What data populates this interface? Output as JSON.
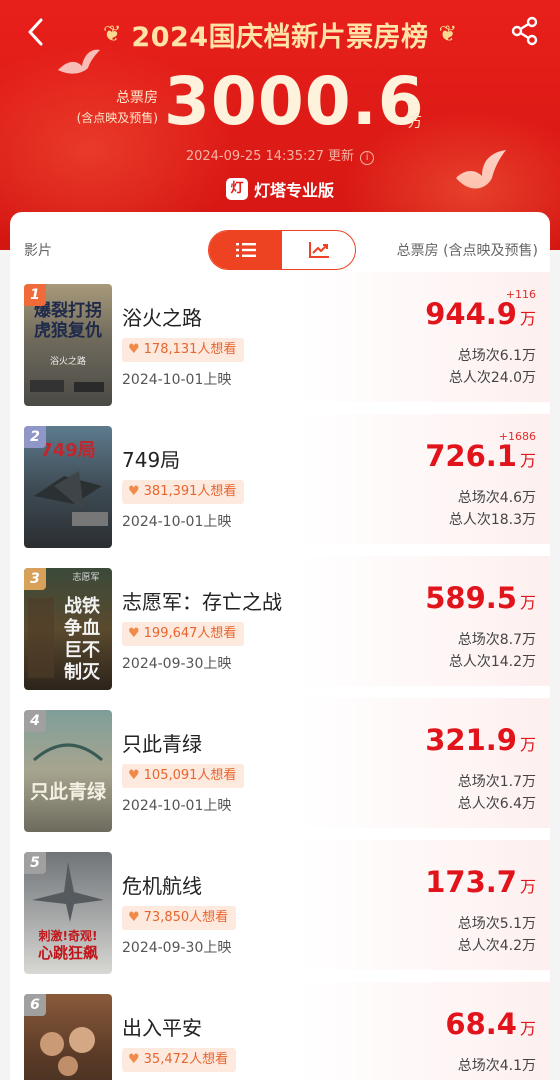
{
  "header": {
    "title": "2024国庆档新片票房榜",
    "total_label": "总票房",
    "total_sub": "(含点映及预售)",
    "total_value": "3000.6",
    "total_unit": "万",
    "update_time": "2024-09-25 14:35:27",
    "update_label": "更新",
    "brand": "灯塔专业版",
    "brand_logo_text": "灯",
    "laurel_left": "❦",
    "laurel_right": "❦"
  },
  "table": {
    "col_film": "影片",
    "col_box": "总票房 (含点映及预售)"
  },
  "colors": {
    "accent": "#e0141a",
    "header_red": "#e8201b",
    "rank1": "#f06a3a",
    "rank2": "#8f97c9",
    "rank3": "#d7a15a",
    "rank_other": "#a0a0a0"
  },
  "movies": [
    {
      "rank": "1",
      "title": "浴火之路",
      "want": "178,131人想看",
      "date": "2024-10-01上映",
      "delta": "+116",
      "box": "944.9",
      "box_unit": "万",
      "sessions": "总场次6.1万",
      "viewers": "总人次24.0万"
    },
    {
      "rank": "2",
      "title": "749局",
      "want": "381,391人想看",
      "date": "2024-10-01上映",
      "delta": "+1686",
      "box": "726.1",
      "box_unit": "万",
      "sessions": "总场次4.6万",
      "viewers": "总人次18.3万"
    },
    {
      "rank": "3",
      "title": "志愿军：存亡之战",
      "want": "199,647人想看",
      "date": "2024-09-30上映",
      "delta": "",
      "box": "589.5",
      "box_unit": "万",
      "sessions": "总场次8.7万",
      "viewers": "总人次14.2万"
    },
    {
      "rank": "4",
      "title": "只此青绿",
      "want": "105,091人想看",
      "date": "2024-10-01上映",
      "delta": "",
      "box": "321.9",
      "box_unit": "万",
      "sessions": "总场次1.7万",
      "viewers": "总人次6.4万"
    },
    {
      "rank": "5",
      "title": "危机航线",
      "want": "73,850人想看",
      "date": "2024-09-30上映",
      "delta": "",
      "box": "173.7",
      "box_unit": "万",
      "sessions": "总场次5.1万",
      "viewers": "总人次4.2万"
    },
    {
      "rank": "6",
      "title": "出入平安",
      "want": "35,472人想看",
      "date": "",
      "delta": "",
      "box": "68.4",
      "box_unit": "万",
      "sessions": "总场次4.1万",
      "viewers": ""
    }
  ],
  "posters": [
    {
      "text": "爆裂打拐\n虎狼复仇",
      "sub": "浴火之路"
    },
    {
      "text": "749局",
      "sub": ""
    },
    {
      "text": "铁血\n战争\n不巨\n灭制",
      "sub": "志愿军"
    },
    {
      "text": "只此青绿",
      "sub": ""
    },
    {
      "text": "刺激!奇观!\n心跳狂飙",
      "sub": ""
    },
    {
      "text": "",
      "sub": ""
    }
  ]
}
